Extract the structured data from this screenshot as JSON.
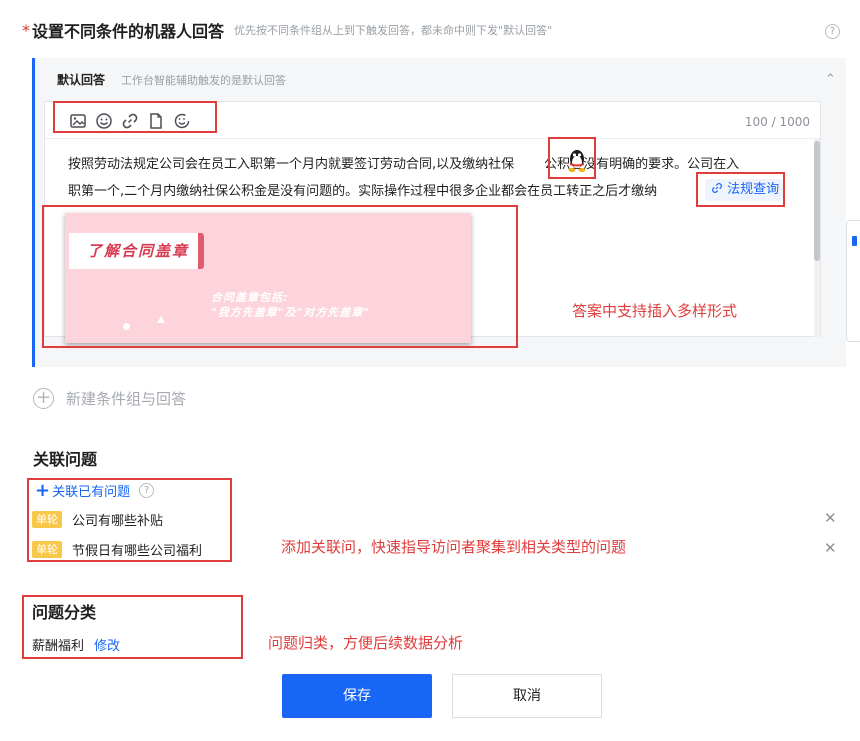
{
  "section_answers": {
    "required_mark": "*",
    "title": "设置不同条件的机器人回答",
    "hint": "优先按不同条件组从上到下触发回答，都未命中则下发\"默认回答\"",
    "help_glyph": "?"
  },
  "default_answer": {
    "title": "默认回答",
    "hint": "工作台智能辅助触发的是默认回答",
    "collapse_glyph": "⌃",
    "counter": "100 / 1000",
    "toolbar": [
      "image-icon",
      "emoji-icon",
      "link-icon",
      "file-icon",
      "emoticon-icon"
    ],
    "paragraph": "按照劳动法规定公司会在员工入职第一个月内就要签订劳动合同,以及缴纳社保",
    "paragraph_after_emoji": "公积金没有明确的要求。公司在入",
    "line2": "职第一个,二个月内缴纳社保公积金是没有问题的。实际操作过程中很多企业都会在员工转正之后才缴纳",
    "law_chip": "法规查询",
    "emoji_icon": "qq-penguin-icon",
    "card": {
      "tab_title": "了解合同盖章",
      "sub_line1": "合同盖章包括:",
      "sub_line2": "\"我方先盖章\"及\"对方先盖章\""
    },
    "annotation": "答案中支持插入多样形式"
  },
  "new_group": {
    "plus_glyph": "+",
    "label": "新建条件组与回答"
  },
  "related": {
    "title": "关联问题",
    "link_plus": "+",
    "link_label": "关联已有问题",
    "help_glyph": "?",
    "close_glyph": "✕",
    "items": [
      {
        "badge": "单轮",
        "text": "公司有哪些补贴"
      },
      {
        "badge": "单轮",
        "text": "节假日有哪些公司福利"
      }
    ],
    "annotation": "添加关联问，快速指导访问者聚集到相关类型的问题"
  },
  "category": {
    "title": "问题分类",
    "value": "薪酬福利",
    "edit": "修改",
    "annotation": "问题归类，方便后续数据分析"
  },
  "actions": {
    "save": "保存",
    "cancel": "取消"
  },
  "colors": {
    "primary": "#1766f5",
    "annotation_red": "#e03c3c",
    "badge_yellow": "#f8c84b"
  }
}
